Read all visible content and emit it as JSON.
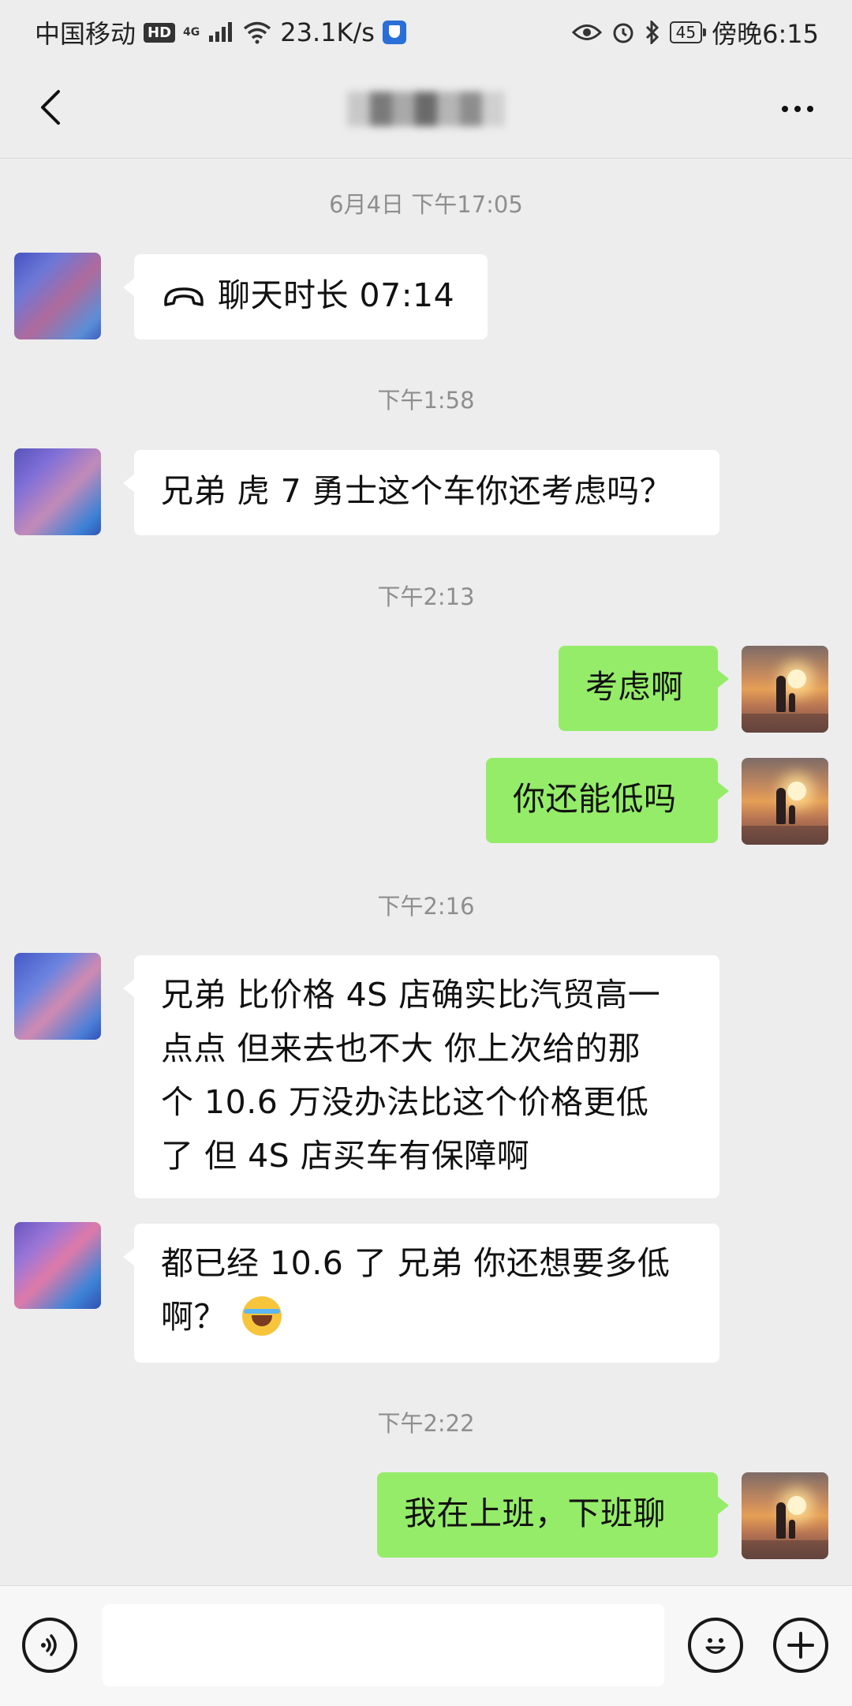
{
  "status_bar": {
    "carrier": "中国移动",
    "hd_badge": "HD",
    "network_mini": "4G",
    "net_speed": "23.1K/s",
    "battery": "45",
    "time": "傍晚6:15",
    "icons": [
      "hd-badge-icon",
      "signal-icon",
      "wifi-icon",
      "shield-icon",
      "eye-icon",
      "alarm-icon",
      "bluetooth-icon",
      "battery-icon"
    ]
  },
  "header": {
    "title": "",
    "back_icon": "chevron-left-icon",
    "more_icon": "more-dots-icon"
  },
  "messages": [
    {
      "type": "time",
      "text": "6月4日 下午17:05"
    },
    {
      "type": "in",
      "kind": "call",
      "icon": "phone-hangup-icon",
      "text": "聊天时长 07:14"
    },
    {
      "type": "time",
      "text": "下午1:58"
    },
    {
      "type": "in",
      "text": "兄弟 虎 7 勇士这个车你还考虑吗？"
    },
    {
      "type": "time",
      "text": "下午2:13"
    },
    {
      "type": "out",
      "text": "考虑啊"
    },
    {
      "type": "out",
      "text": "你还能低吗"
    },
    {
      "type": "time",
      "text": "下午2:16"
    },
    {
      "type": "in",
      "lines": [
        "兄弟 比价格 4S 店确实比汽贸高一",
        "点点 但来去也不大 你上次给的那",
        "个 10.6 万没办法比这个价格更低",
        "了 但 4S 店买车有保障啊"
      ]
    },
    {
      "type": "in",
      "lines": [
        "都已经 10.6 了 兄弟 你还想要多低",
        "啊？"
      ],
      "emoji": "crying-laughing-emoji"
    },
    {
      "type": "time",
      "text": "下午2:22"
    },
    {
      "type": "out",
      "text": "我在上班，下班聊"
    }
  ],
  "input_bar": {
    "voice_icon": "voice-icon",
    "emoji_icon": "emoji-icon",
    "plus_icon": "plus-icon",
    "input_value": ""
  },
  "colors": {
    "background": "#ededed",
    "incoming_bubble": "#ffffff",
    "outgoing_bubble": "#95ec69",
    "timestamp": "#8e8e8e"
  }
}
